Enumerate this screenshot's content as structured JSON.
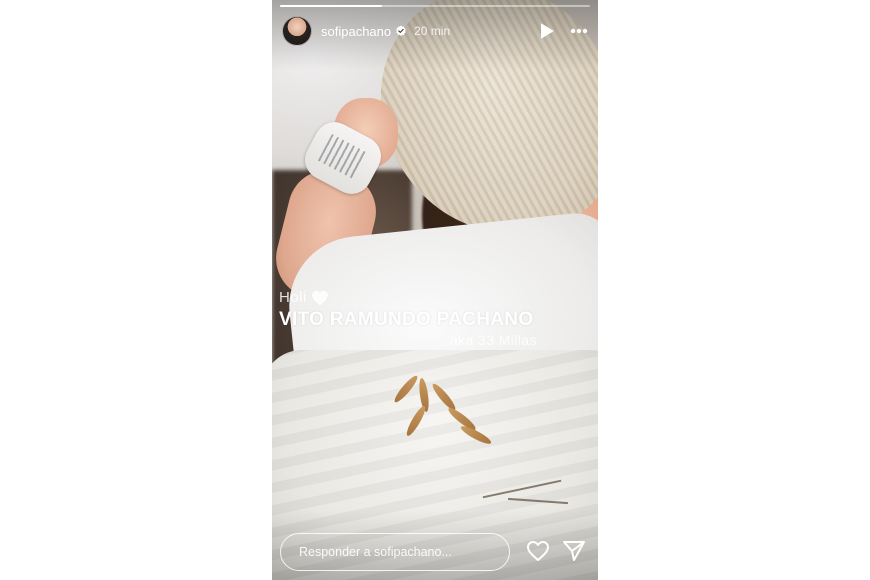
{
  "story": {
    "username": "sofipachano",
    "verified": true,
    "time_ago": "20 min",
    "progress": 0.33
  },
  "overlay": {
    "line1": "Holi",
    "line2": "VITO RAMUNDO PACHANO",
    "line3": "aka 33 Millas"
  },
  "footer": {
    "reply_placeholder": "Responder a sofipachano..."
  },
  "icons": {
    "verified": "verified-badge-icon",
    "play": "play-icon",
    "more": "more-options-icon",
    "heart": "heart-icon",
    "send": "send-icon"
  },
  "colors": {
    "verified_badge": "#ffffff",
    "text": "#ffffff"
  }
}
